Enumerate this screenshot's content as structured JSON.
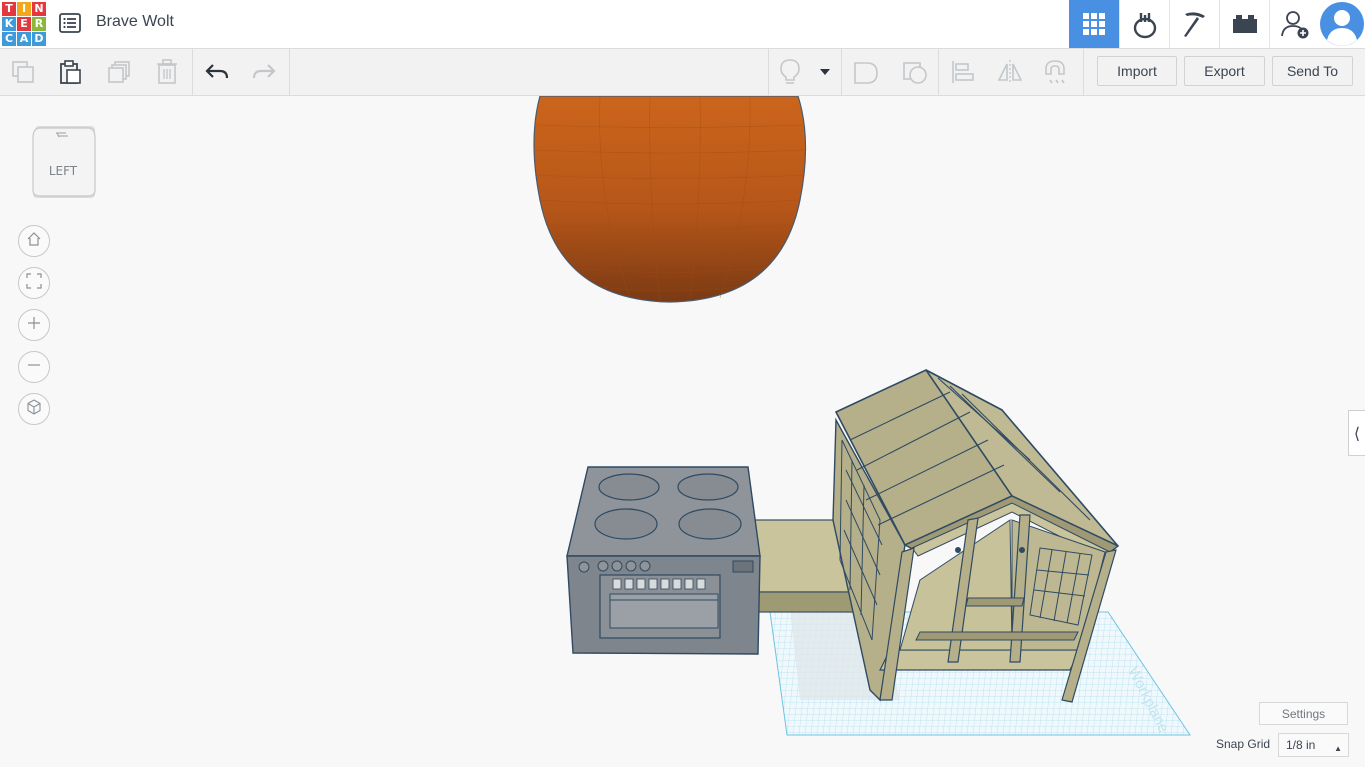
{
  "app": {
    "logo_letters": [
      "T",
      "I",
      "N",
      "K",
      "E",
      "R",
      "C",
      "A",
      "D"
    ],
    "logo_colors": [
      "#e3383d",
      "#f2a71c",
      "#e3383d",
      "#3f9ad9",
      "#e3383d",
      "#8ab83b",
      "#3f9ad9",
      "#3f9ad9",
      "#3f9ad9"
    ],
    "design_title": "Brave Wolt"
  },
  "top_icons": [
    "3d-design-grid-icon",
    "circuits-icon",
    "minecraft-pickaxe-icon",
    "lego-brick-icon",
    "add-user-icon",
    "user-avatar-icon"
  ],
  "toolbar": {
    "import_label": "Import",
    "export_label": "Export",
    "send_to_label": "Send To"
  },
  "viewcube": {
    "face_label": "LEFT"
  },
  "footer": {
    "settings_label": "Settings",
    "snap_grid_label": "Snap Grid",
    "snap_grid_value": "1/8 in"
  },
  "workplane": {
    "label": "Workplane"
  },
  "colors": {
    "accent": "#4a90e2",
    "sphere": "#c35d1a",
    "shape_gray": "#8e949a",
    "shelter": "#b5b08a"
  }
}
